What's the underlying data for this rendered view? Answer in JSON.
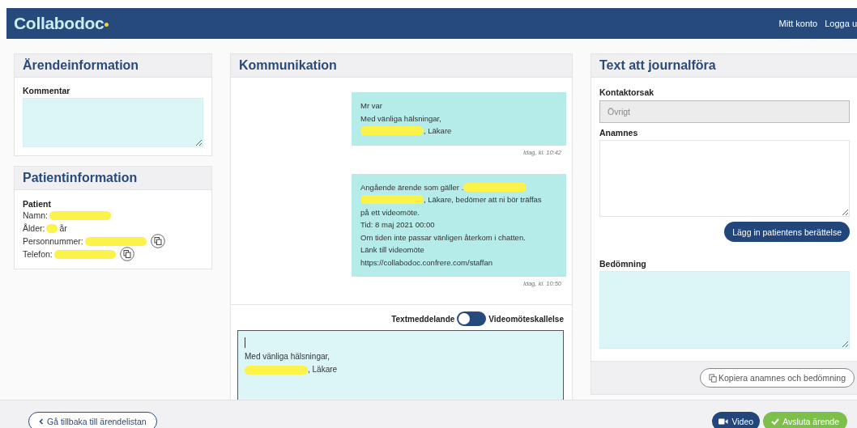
{
  "header": {
    "logo": "Collabodoc",
    "nav": [
      "Mitt konto",
      "Logga u"
    ]
  },
  "case_panel": {
    "title": "Ärendeinformation",
    "comment_label": "Kommentar"
  },
  "patient_panel": {
    "title": "Patientinformation",
    "heading": "Patient",
    "rows": [
      {
        "label": "Namn:",
        "kind": "wide",
        "copy": false
      },
      {
        "label": "Ålder:",
        "kind": "narrow",
        "suffix": "år",
        "copy": false
      },
      {
        "label": "Personnummer:",
        "kind": "wide",
        "copy": true
      },
      {
        "label": "Telefon:",
        "kind": "wide",
        "copy": true
      }
    ]
  },
  "communication": {
    "title": "Kommunikation",
    "messages": [
      {
        "lines": [
          {
            "text": "Mr var"
          },
          {
            "text": "Med vänliga hälsningar,"
          },
          {
            "text": ", Läkare",
            "masked_before": true
          }
        ],
        "time": "Idag, kl. 10:42"
      },
      {
        "lines": [
          {
            "text": "Angående ärende som gäller .",
            "masked_after": true
          },
          {
            "text": ", Läkare, bedömer att ni bör träffas",
            "masked_before": true
          },
          {
            "text": "på ett videomöte."
          },
          {
            "text": "Tid: 8 maj 2021 00:00"
          },
          {
            "text": "Om tiden inte passar vänligen återkom i chatten."
          },
          {
            "text": "Länk till videomöte"
          },
          {
            "text": "https://collabodoc.confrere.com/staffan"
          }
        ],
        "time": "Idag, kl. 10:50"
      }
    ],
    "toggle": {
      "left_label": "Textmeddelande",
      "right_label": "Videomöteskallelse",
      "on": false
    },
    "draft": {
      "lines": [
        {
          "text": "Med vänliga hälsningar,"
        },
        {
          "text": ", Läkare",
          "masked_before": true
        }
      ]
    }
  },
  "journal_panel": {
    "title": "Text att journalföra",
    "contact_label": "Kontaktorsak",
    "contact_value": "Övrigt",
    "contact_disabled": true,
    "anamnes_label": "Anamnes",
    "insert_button": "Lägg in patientens berättelse",
    "assessment_label": "Bedömning",
    "copy_button": "Kopiera anamnes och bedömning"
  },
  "footer": {
    "back_button": "Gå tillbaka till ärendelistan",
    "video_button": "Video",
    "finish_button": "Avsluta ärende"
  }
}
